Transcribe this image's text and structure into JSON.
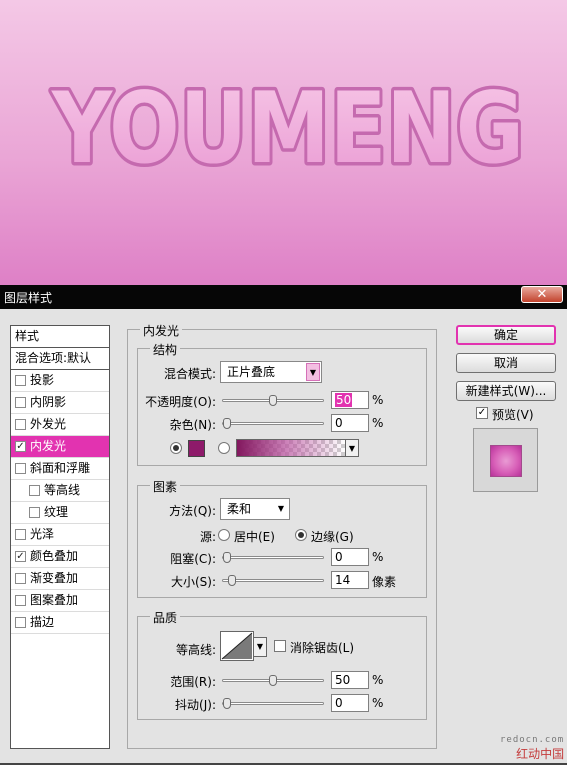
{
  "canvas": {
    "text": "YOUMENG"
  },
  "dialog": {
    "title": "图层样式",
    "close_symbol": "✕",
    "styles_header": "样式",
    "blend_options": "混合选项:默认",
    "effects": [
      {
        "label": "投影",
        "checked": false,
        "indent": false
      },
      {
        "label": "内阴影",
        "checked": false,
        "indent": false
      },
      {
        "label": "外发光",
        "checked": false,
        "indent": false
      },
      {
        "label": "内发光",
        "checked": true,
        "indent": false,
        "selected": true
      },
      {
        "label": "斜面和浮雕",
        "checked": false,
        "indent": false
      },
      {
        "label": "等高线",
        "checked": false,
        "indent": true
      },
      {
        "label": "纹理",
        "checked": false,
        "indent": true
      },
      {
        "label": "光泽",
        "checked": false,
        "indent": false
      },
      {
        "label": "颜色叠加",
        "checked": true,
        "indent": false
      },
      {
        "label": "渐变叠加",
        "checked": false,
        "indent": false
      },
      {
        "label": "图案叠加",
        "checked": false,
        "indent": false
      },
      {
        "label": "描边",
        "checked": false,
        "indent": false
      }
    ],
    "panel_title": "内发光",
    "structure": {
      "legend": "结构",
      "blend_mode_label": "混合模式:",
      "blend_mode_value": "正片叠底",
      "opacity_label": "不透明度(O):",
      "opacity_value": "50",
      "opacity_level": 50,
      "noise_label": "杂色(N):",
      "noise_value": "0",
      "noise_level": 0,
      "percent": "%",
      "glow_color": "#8e1a6a"
    },
    "elements": {
      "legend": "图素",
      "technique_label": "方法(Q):",
      "technique_value": "柔和",
      "source_label": "源:",
      "source_center": "居中(E)",
      "source_edge": "边缘(G)",
      "choke_label": "阻塞(C):",
      "choke_value": "0",
      "choke_level": 0,
      "size_label": "大小(S):",
      "size_value": "14",
      "size_level": 5,
      "size_unit": "像素",
      "percent": "%"
    },
    "quality": {
      "legend": "品质",
      "contour_label": "等高线:",
      "anti_alias_label": "消除锯齿(L)",
      "range_label": "范围(R):",
      "range_value": "50",
      "range_level": 50,
      "jitter_label": "抖动(J):",
      "jitter_value": "0",
      "jitter_level": 0,
      "percent": "%"
    },
    "buttons": {
      "ok": "确定",
      "cancel": "取消",
      "new_style": "新建样式(W)...",
      "preview": "预览(V)"
    },
    "watermark": {
      "site": "redocn.com",
      "name": "红动中国"
    }
  }
}
